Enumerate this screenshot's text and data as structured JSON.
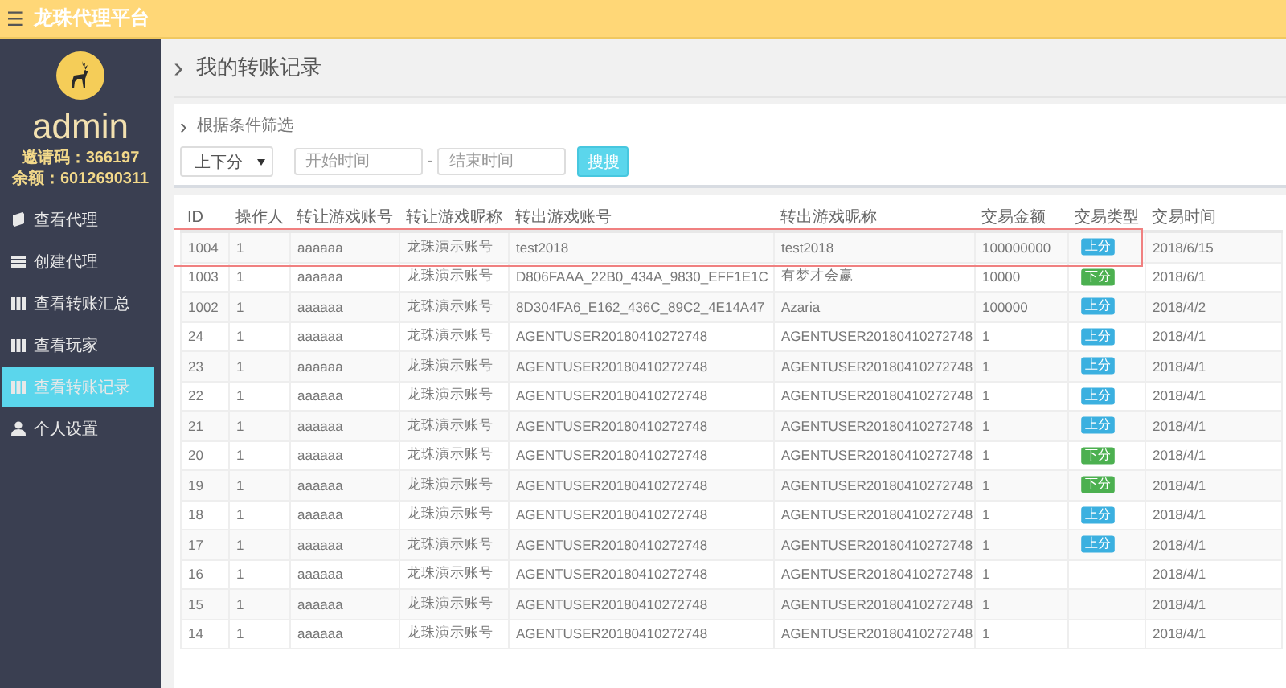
{
  "topbar": {
    "menu_glyph": "☰",
    "title": "龙珠代理平台"
  },
  "sidebar": {
    "username": "admin",
    "invite_label": "邀请码：",
    "invite_code": "366197",
    "balance_label": "余额：",
    "balance": "6012690311",
    "items": [
      {
        "label": "查看代理",
        "kind": "book",
        "selected": false
      },
      {
        "label": "创建代理",
        "kind": "list",
        "selected": false
      },
      {
        "label": "查看转账汇总",
        "kind": "grid",
        "selected": false
      },
      {
        "label": "查看玩家",
        "kind": "grid",
        "selected": false
      },
      {
        "label": "查看转账记录",
        "kind": "grid",
        "selected": true
      },
      {
        "label": "个人设置",
        "kind": "user",
        "selected": false
      }
    ]
  },
  "page_title_glyph": "›",
  "page_title": "我的转账记录",
  "filter": {
    "title_glyph": "›",
    "title": "根据条件筛选",
    "select_value": "上下分",
    "start_placeholder": "开始时间",
    "separator": "-",
    "end_placeholder": "结束时间",
    "search_button": "搜搜"
  },
  "table": {
    "columns": [
      "ID",
      "操作人",
      "转让游戏账号",
      "转让游戏昵称",
      "转出游戏账号",
      "转出游戏昵称",
      "交易金额",
      "交易类型",
      "交易时间"
    ],
    "rows": [
      {
        "id": "1004",
        "operator": "1",
        "from_account": "aaaaaa",
        "from_nick": "龙珠演示账号",
        "to_account": "test2018",
        "to_nick": "test2018",
        "amount": "100000000",
        "kind": "up",
        "type_label": "上分",
        "time": "2018/6/15",
        "highlighted": true
      },
      {
        "id": "1003",
        "operator": "1",
        "from_account": "aaaaaa",
        "from_nick": "龙珠演示账号",
        "to_account": "D806FAAA_22B0_434A_9830_EFF1E1C",
        "to_nick": "有梦才会赢",
        "amount": "10000",
        "kind": "down",
        "type_label": "下分",
        "time": "2018/6/1",
        "highlighted": false
      },
      {
        "id": "1002",
        "operator": "1",
        "from_account": "aaaaaa",
        "from_nick": "龙珠演示账号",
        "to_account": "8D304FA6_E162_436C_89C2_4E14A47",
        "to_nick": "Azaria",
        "amount": "100000",
        "kind": "up",
        "type_label": "上分",
        "time": "2018/4/2",
        "highlighted": false
      },
      {
        "id": "24",
        "operator": "1",
        "from_account": "aaaaaa",
        "from_nick": "龙珠演示账号",
        "to_account": "AGENTUSER20180410272748",
        "to_nick": "AGENTUSER20180410272748",
        "amount": "1",
        "kind": "up",
        "type_label": "上分",
        "time": "2018/4/1",
        "highlighted": false
      },
      {
        "id": "23",
        "operator": "1",
        "from_account": "aaaaaa",
        "from_nick": "龙珠演示账号",
        "to_account": "AGENTUSER20180410272748",
        "to_nick": "AGENTUSER20180410272748",
        "amount": "1",
        "kind": "up",
        "type_label": "上分",
        "time": "2018/4/1",
        "highlighted": false
      },
      {
        "id": "22",
        "operator": "1",
        "from_account": "aaaaaa",
        "from_nick": "龙珠演示账号",
        "to_account": "AGENTUSER20180410272748",
        "to_nick": "AGENTUSER20180410272748",
        "amount": "1",
        "kind": "up",
        "type_label": "上分",
        "time": "2018/4/1",
        "highlighted": false
      },
      {
        "id": "21",
        "operator": "1",
        "from_account": "aaaaaa",
        "from_nick": "龙珠演示账号",
        "to_account": "AGENTUSER20180410272748",
        "to_nick": "AGENTUSER20180410272748",
        "amount": "1",
        "kind": "up",
        "type_label": "上分",
        "time": "2018/4/1",
        "highlighted": false
      },
      {
        "id": "20",
        "operator": "1",
        "from_account": "aaaaaa",
        "from_nick": "龙珠演示账号",
        "to_account": "AGENTUSER20180410272748",
        "to_nick": "AGENTUSER20180410272748",
        "amount": "1",
        "kind": "down",
        "type_label": "下分",
        "time": "2018/4/1",
        "highlighted": false
      },
      {
        "id": "19",
        "operator": "1",
        "from_account": "aaaaaa",
        "from_nick": "龙珠演示账号",
        "to_account": "AGENTUSER20180410272748",
        "to_nick": "AGENTUSER20180410272748",
        "amount": "1",
        "kind": "down",
        "type_label": "下分",
        "time": "2018/4/1",
        "highlighted": false
      },
      {
        "id": "18",
        "operator": "1",
        "from_account": "aaaaaa",
        "from_nick": "龙珠演示账号",
        "to_account": "AGENTUSER20180410272748",
        "to_nick": "AGENTUSER20180410272748",
        "amount": "1",
        "kind": "up",
        "type_label": "上分",
        "time": "2018/4/1",
        "highlighted": false
      },
      {
        "id": "17",
        "operator": "1",
        "from_account": "aaaaaa",
        "from_nick": "龙珠演示账号",
        "to_account": "AGENTUSER20180410272748",
        "to_nick": "AGENTUSER20180410272748",
        "amount": "1",
        "kind": "up",
        "type_label": "上分",
        "time": "2018/4/1",
        "highlighted": false
      },
      {
        "id": "16",
        "operator": "1",
        "from_account": "aaaaaa",
        "from_nick": "龙珠演示账号",
        "to_account": "AGENTUSER20180410272748",
        "to_nick": "AGENTUSER20180410272748",
        "amount": "1",
        "time": "2018/4/1",
        "highlighted": false
      },
      {
        "id": "15",
        "operator": "1",
        "from_account": "aaaaaa",
        "from_nick": "龙珠演示账号",
        "to_account": "AGENTUSER20180410272748",
        "to_nick": "AGENTUSER20180410272748",
        "amount": "1",
        "time": "2018/4/1",
        "highlighted": false
      },
      {
        "id": "14",
        "operator": "1",
        "from_account": "aaaaaa",
        "from_nick": "龙珠演示账号",
        "to_account": "AGENTUSER20180410272748",
        "to_nick": "AGENTUSER20180410272748",
        "amount": "1",
        "time": "2018/4/1",
        "highlighted": false
      }
    ]
  }
}
